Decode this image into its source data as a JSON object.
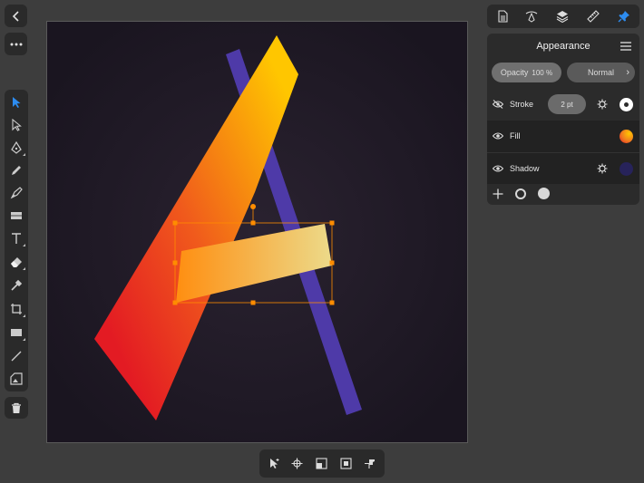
{
  "left_controls": {
    "back_icon": "chevron-left",
    "more_icon": "ellipsis"
  },
  "tools": [
    {
      "name": "move-tool",
      "icon": "pointer-arrow",
      "active": true
    },
    {
      "name": "node-tool",
      "icon": "hollow-arrow",
      "active": false
    },
    {
      "name": "pen-tool",
      "icon": "pen",
      "active": false
    },
    {
      "name": "pencil-tool",
      "icon": "pencil",
      "active": false
    },
    {
      "name": "vector-brush-tool",
      "icon": "brush",
      "active": false
    },
    {
      "name": "fill-tool",
      "icon": "gradient",
      "active": false
    },
    {
      "name": "text-tool",
      "icon": "text-T",
      "active": false
    },
    {
      "name": "eraser-tool",
      "icon": "eraser",
      "active": false
    },
    {
      "name": "color-picker-tool",
      "icon": "eyedropper",
      "active": false
    },
    {
      "name": "crop-tool",
      "icon": "crop",
      "active": false
    },
    {
      "name": "rectangle-tool",
      "icon": "rectangle",
      "active": false
    },
    {
      "name": "line-tool",
      "icon": "line",
      "active": false
    },
    {
      "name": "place-tool",
      "icon": "place-image",
      "active": false
    }
  ],
  "trash_icon": "trash",
  "studio_tabs": [
    {
      "name": "document",
      "icon": "document",
      "active": false
    },
    {
      "name": "stroke-studio",
      "icon": "pen-curve",
      "active": false
    },
    {
      "name": "layers",
      "icon": "layers",
      "active": false
    },
    {
      "name": "transform",
      "icon": "ruler",
      "active": false
    },
    {
      "name": "appearance",
      "icon": "pin",
      "active": true
    }
  ],
  "appearance": {
    "title": "Appearance",
    "opacity_label": "Opacity",
    "opacity_value": "100 %",
    "blend_mode": "Normal",
    "rows": [
      {
        "label": "Stroke",
        "visible": false,
        "width": "2 pt",
        "swatch": "#ffffff"
      },
      {
        "label": "Fill",
        "visible": true,
        "swatch": "#f07a20"
      },
      {
        "label": "Shadow",
        "visible": true,
        "swatch": "#27235a"
      }
    ]
  },
  "context_bar": [
    {
      "name": "select-behind",
      "icon": "arrow-select"
    },
    {
      "name": "snapping",
      "icon": "crosshair"
    },
    {
      "name": "transform-origin",
      "icon": "square-corner"
    },
    {
      "name": "selection-box",
      "icon": "square-center"
    },
    {
      "name": "pin",
      "icon": "pushpin"
    }
  ],
  "colors": {
    "accent": "#2d8cf0",
    "selection": "#ff8c00",
    "canvas": "#1c1721",
    "gradient_start": "#e31b23",
    "gradient_end": "#ffc600",
    "band": "#4e3aa8",
    "bar_start": "#ff8e10",
    "bar_end": "#ecda8a"
  }
}
